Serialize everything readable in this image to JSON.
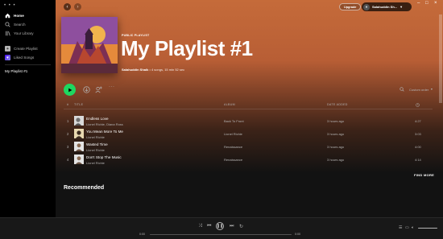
{
  "sidebar": {
    "window_menu": "• • •",
    "nav": [
      {
        "label": "Home"
      },
      {
        "label": "Search"
      },
      {
        "label": "Your Library"
      }
    ],
    "create_playlist": "Create Playlist",
    "liked_songs": "Liked Songs",
    "playlists": [
      "My Playlist #1"
    ]
  },
  "topbar": {
    "upgrade": "Upgrade",
    "user_name": "Salahuddin Sh..."
  },
  "playlist": {
    "type": "PUBLIC PLAYLIST",
    "title": "My Playlist #1",
    "owner": "Salahuddin Shaik",
    "meta": " • 4 songs, 15 min 52 sec"
  },
  "actions": {
    "sort_label": "Custom order"
  },
  "table": {
    "headers": {
      "num": "#",
      "title": "TITLE",
      "album": "ALBUM",
      "date": "DATE ADDED"
    },
    "rows": [
      {
        "num": "1",
        "title": "Endless Love",
        "artist": "Lionel Richie, Diana Ross",
        "album": "Back To Front",
        "added": "3 hours ago",
        "duration": "4:27"
      },
      {
        "num": "2",
        "title": "You Mean More To Me",
        "artist": "Lionel Richie",
        "album": "Lionel Richie",
        "added": "3 hours ago",
        "duration": "3:03"
      },
      {
        "num": "3",
        "title": "Wasted Time",
        "artist": "Lionel Richie",
        "album": "Renaissance",
        "added": "3 hours ago",
        "duration": "4:00"
      },
      {
        "num": "4",
        "title": "Don't Stop The Music",
        "artist": "Lionel Richie",
        "album": "Renaissance",
        "added": "3 hours ago",
        "duration": "4:14"
      }
    ]
  },
  "find_more": "FIND MORE",
  "recommended": "Recommended",
  "player": {
    "time_elapsed": "0:00",
    "time_total": "0:00"
  },
  "colors": {
    "accent": "#1ed760",
    "hero_top": "#c56b3a",
    "background": "#121212"
  }
}
